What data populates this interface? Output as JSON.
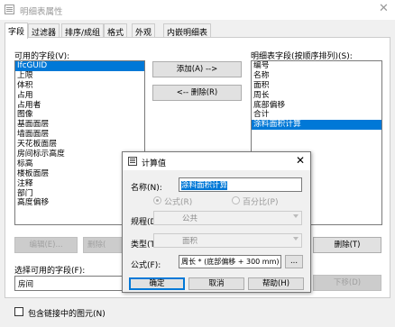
{
  "window": {
    "title": "明细表属性",
    "close_glyph": "✕"
  },
  "tabs": [
    "字段",
    "过滤器",
    "排序/成组",
    "格式",
    "外观",
    "内嵌明细表"
  ],
  "available": {
    "label": "可用的字段(V):",
    "items": [
      "IfcGUID",
      "上限",
      "体积",
      "占用",
      "占用者",
      "图像",
      "基面面层",
      "墙面面层",
      "天花板面层",
      "房间标示高度",
      "标高",
      "楼板面层",
      "注释",
      "部门",
      "高度偏移"
    ],
    "selected_index": 0
  },
  "buttons": {
    "add": "添加(A) -->",
    "remove": "<-- 删除(R)",
    "edit": "编辑(E)...",
    "delete_left": "删除(",
    "delete": "删除(T)",
    "move_down": "下移(D)"
  },
  "scheduled": {
    "label": "明细表字段(按顺序排列)(S):",
    "items": [
      "编号",
      "名称",
      "面积",
      "周长",
      "底部偏移",
      "合计",
      "涂料面积计算"
    ],
    "selected_index": 6
  },
  "select_from": {
    "label": "选择可用的字段(F):",
    "value": "房间"
  },
  "include_linked": {
    "label": "包含链接中的图元(N)",
    "checked": false
  },
  "dialog": {
    "title": "计算值",
    "close_glyph": "✕",
    "name_label": "名称(N):",
    "name_value": "涂料面积计算",
    "formula_radio": "公式(R)",
    "percent_radio": "百分比(P)",
    "discipline_label": "规程(D):",
    "discipline_value": "公共",
    "type_label": "类型(T):",
    "type_value": "面积",
    "formula_label": "公式(F):",
    "formula_value": "周长 * (底部偏移 + 300 mm)",
    "ellipsis": "...",
    "ok": "确定",
    "cancel": "取消",
    "help": "帮助(H)"
  }
}
